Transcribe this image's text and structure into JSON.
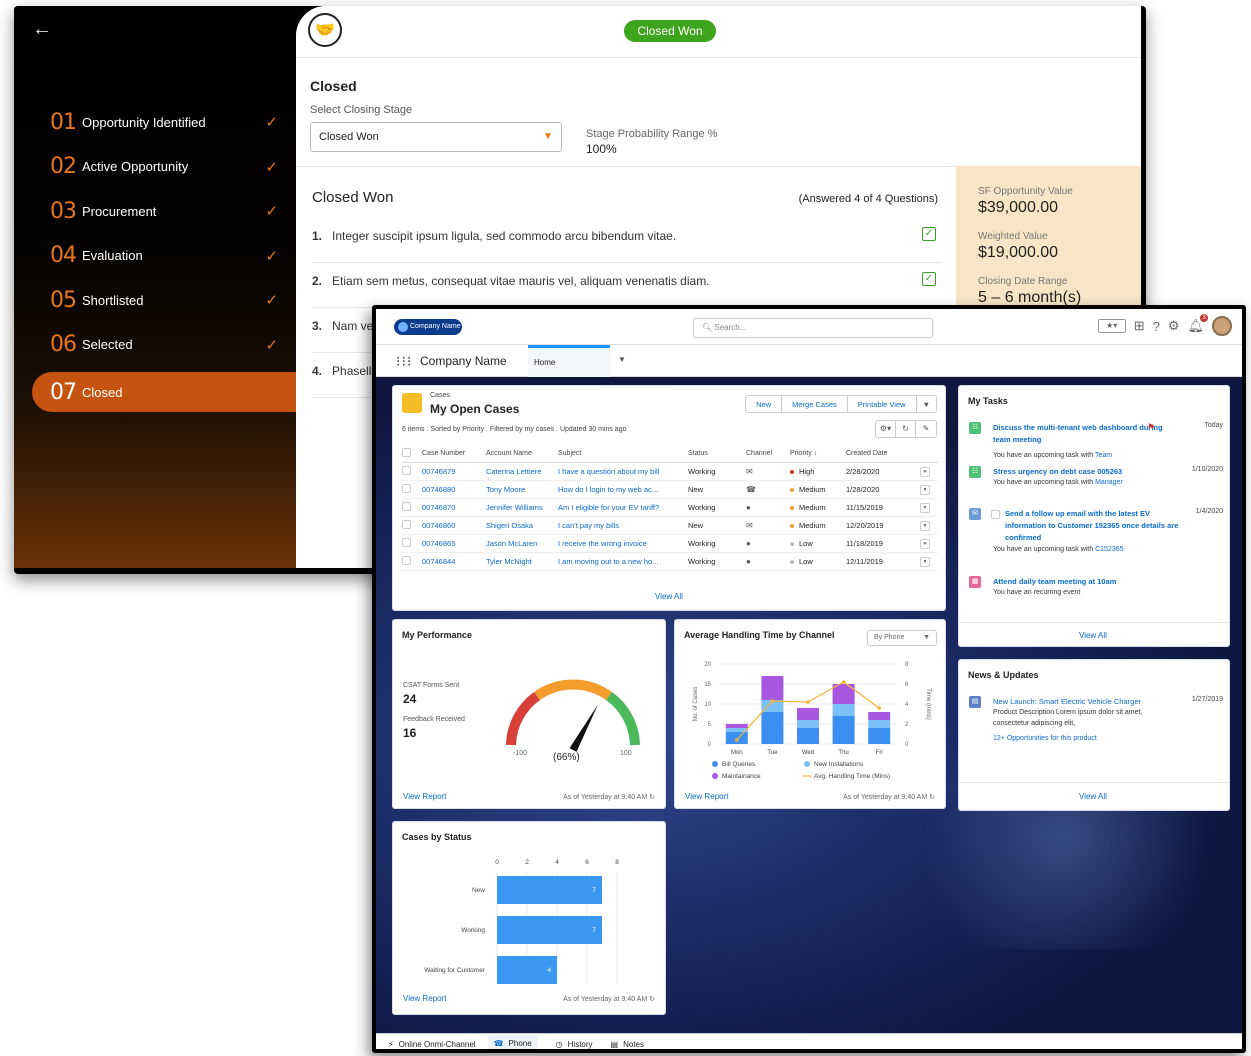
{
  "opportunity": {
    "stages": [
      {
        "num": "01",
        "label": "Opportunity Identified"
      },
      {
        "num": "02",
        "label": "Active Opportunity"
      },
      {
        "num": "03",
        "label": "Procurement"
      },
      {
        "num": "04",
        "label": "Evaluation"
      },
      {
        "num": "05",
        "label": "Shortlisted"
      },
      {
        "num": "06",
        "label": "Selected"
      },
      {
        "num": "07",
        "label": "Closed"
      }
    ],
    "status_pill": "Closed Won",
    "section_title": "Closed",
    "select_label": "Select Closing Stage",
    "select_value": "Closed Won",
    "prob_label": "Stage Probability Range %",
    "prob_value": "100%",
    "questions_title": "Closed Won",
    "answered": "(Answered 4 of 4 Questions)",
    "questions": [
      {
        "n": "1.",
        "text": "Integer suscipit ipsum ligula, sed commodo arcu bibendum vitae."
      },
      {
        "n": "2.",
        "text": "Etiam sem metus, consequat vitae mauris vel, aliquam venenatis diam."
      },
      {
        "n": "3.",
        "text": "Nam ve"
      },
      {
        "n": "4.",
        "text": "Phasell"
      }
    ],
    "sf_value_label": "SF Opportunity Value",
    "sf_value": "$39,000.00",
    "weighted_label": "Weighted Value",
    "weighted_value": "$19,000.00",
    "closing_label": "Closing Date Range",
    "closing_value": "5 – 6 month(s)"
  },
  "console": {
    "logo": "Company Name",
    "search_placeholder": "Search...",
    "app_name": "Company Name",
    "tab": "Home",
    "cases": {
      "eyebrow": "Cases",
      "title": "My Open Cases",
      "meta": "6 items . Sorted by Priority . Filtered by my cases . Updated 30 mins ago",
      "buttons": [
        "New",
        "Merge Cases",
        "Printable View"
      ],
      "columns": [
        "Case Number",
        "Account Name",
        "Subject",
        "Status",
        "Channel",
        "Priority ↓",
        "Created Date"
      ],
      "rows": [
        {
          "num": "00746879",
          "account": "Caterina Lettiere",
          "subject": "I have a question about my bill",
          "status": "Working",
          "channel": "✉",
          "priority": "High",
          "pcolor": "#c23934",
          "date": "2/28/2020"
        },
        {
          "num": "00746880",
          "account": "Tony Moore",
          "subject": "How do I login to my web ac...",
          "status": "New",
          "channel": "☎",
          "priority": "Medium",
          "pcolor": "#f59b2d",
          "date": "1/28/2020"
        },
        {
          "num": "00746870",
          "account": "Jennifer Williams",
          "subject": "Am I eligible for your EV tariff?",
          "status": "Working",
          "channel": "●",
          "priority": "Medium",
          "pcolor": "#f59b2d",
          "date": "11/15/2019"
        },
        {
          "num": "00746860",
          "account": "Shigeri Osaka",
          "subject": "I can't pay my bills",
          "status": "New",
          "channel": "✉",
          "priority": "Medium",
          "pcolor": "#f59b2d",
          "date": "12/20/2019"
        },
        {
          "num": "00746865",
          "account": "Jason McLaren",
          "subject": "I receive the wrong invoice",
          "status": "Working",
          "channel": "●",
          "priority": "Low",
          "pcolor": "#bbbbbb",
          "date": "11/18/2019"
        },
        {
          "num": "00746844",
          "account": "Tyler McNight",
          "subject": "I am moving out to a new ho...",
          "status": "Working",
          "channel": "●",
          "priority": "Low",
          "pcolor": "#bbbbbb",
          "date": "12/11/2019"
        }
      ],
      "view_all": "View All"
    },
    "tasks": {
      "title": "My Tasks",
      "items": [
        {
          "title": "Discuss the multi-tenant web dashboard during team meeting",
          "date": "Today",
          "sub": "You have an upcoming task with",
          "who": "Team"
        },
        {
          "title": "Stress urgency on debt case 005263",
          "date": "1/10/2020",
          "sub": "You have an upcoming task with",
          "who": "Manager"
        },
        {
          "title": "Send a follow up email with the latest EV information to Customer 152365 once details are confirmed",
          "date": "1/4/2020",
          "sub": "You have an upcoming task with",
          "who": "C152365"
        },
        {
          "title": "Attend daily team meeting at 10am",
          "date": "",
          "sub": "You have an recurring event",
          "who": ""
        }
      ],
      "view_all": "View All"
    },
    "news": {
      "title": "News & Updates",
      "item_title": "New Launch: Smart Electric Vehicle Charger",
      "item_date": "1/27/2019",
      "item_desc1": "Product Description Lorem ipsum dolor sit amet,",
      "item_desc2": "consectetur adipiscing elit,",
      "item_link": "12+ Opportunities for this product",
      "view_all": "View All"
    },
    "performance": {
      "title": "My Performance",
      "csat_label": "CSAT Forms Sent",
      "csat_value": "24",
      "feedback_label": "Feedback Received",
      "feedback_value": "16",
      "gauge_min": "-100",
      "gauge_max": "100",
      "gauge_value": "(66%)",
      "gauge_fraction": 0.66,
      "view_report": "View Report",
      "as_of": "As of Yesterday at 9:40 AM"
    },
    "aht": {
      "title": "Average Handling Time by Channel",
      "dropdown": "By Phone",
      "view_report": "View Report",
      "as_of": "As of Yesterday at 9:40 AM"
    },
    "status_chart": {
      "title": "Cases by Status",
      "view_report": "View Report",
      "as_of": "As of Yesterday at 9:40 AM"
    },
    "utility": [
      "Online Onmi-Channel",
      "Phone",
      "History",
      "Notes"
    ],
    "colors": {
      "brand": "#0b6bcb",
      "bar": "#3b98f0",
      "orange": "#e8761c"
    }
  },
  "chart_data": [
    {
      "type": "bar",
      "title": "Average Handling Time by Channel",
      "categories": [
        "Mon",
        "Tue",
        "Wed",
        "Thu",
        "Fri"
      ],
      "ylabel": "No. of Cases",
      "y2label": "Time (mins)",
      "ylim": [
        0,
        20
      ],
      "y2lim": [
        0,
        8
      ],
      "yticks": [
        0,
        5,
        10,
        15,
        20
      ],
      "y2ticks": [
        0,
        2,
        4,
        6,
        8
      ],
      "series": [
        {
          "name": "Bill Queries",
          "color": "#3b8ff0",
          "values": [
            3,
            8,
            4,
            7,
            4
          ]
        },
        {
          "name": "New Installations",
          "color": "#7cc0fa",
          "values": [
            1,
            3,
            2,
            3,
            2
          ]
        },
        {
          "name": "Maintainance",
          "color": "#a858e0",
          "values": [
            1,
            6,
            3,
            5,
            2
          ]
        },
        {
          "name": "Avg. Handling Time (Mins)",
          "type": "line",
          "color": "#f3b234",
          "values": [
            0.4,
            4.3,
            4.2,
            6.2,
            3.6
          ]
        }
      ]
    },
    {
      "type": "bar",
      "orientation": "horizontal",
      "title": "Cases by Status",
      "categories": [
        "New",
        "Working",
        "Waiting for Customer"
      ],
      "values": [
        7,
        7,
        4
      ],
      "xlim": [
        0,
        8
      ],
      "xticks": [
        0,
        2,
        4,
        6,
        8
      ]
    }
  ]
}
